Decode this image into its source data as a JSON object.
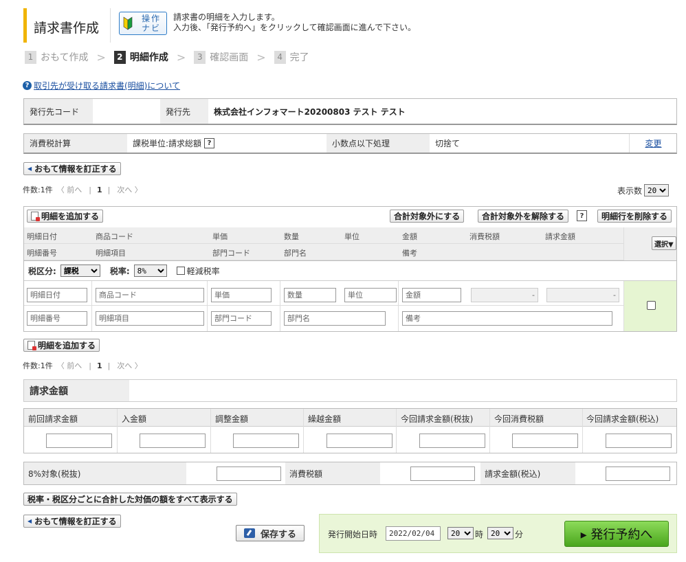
{
  "header": {
    "title": "請求書作成",
    "navi_label": "操作ナビ",
    "instruction_line1": "請求書の明細を入力します。",
    "instruction_line2": "入力後、「発行予約へ」をクリックして確認画面に進んで下さい。"
  },
  "steps": [
    {
      "num": "1",
      "label": "おもて作成"
    },
    {
      "num": "2",
      "label": "明細作成"
    },
    {
      "num": "3",
      "label": "確認画面"
    },
    {
      "num": "4",
      "label": "完了"
    }
  ],
  "help_link": "取引先が受け取る請求書(明細)について",
  "issuer": {
    "code_label": "発行先コード",
    "code_value": "",
    "name_label": "発行先",
    "name_value": "株式会社インフォマート20200803 テスト テスト"
  },
  "tax": {
    "calc_label": "消費税計算",
    "unit_value": "課税単位:請求総額",
    "decimal_label": "小数点以下処理",
    "decimal_value": "切捨て",
    "change_link": "変更"
  },
  "correct_button": "おもて情報を訂正する",
  "pager": {
    "count": "件数:1件",
    "prev": "〈 前へ",
    "page": "1",
    "next": "次へ 〉"
  },
  "display_count_label": "表示数",
  "display_count_value": "20",
  "toolbar": {
    "add_detail": "明細を追加する",
    "set_total": "合計対象外にする",
    "unset_total": "合計対象外を解除する",
    "delete_row": "明細行を削除する",
    "select": "選択▼"
  },
  "grid_header": {
    "row1": [
      "明細日付",
      "商品コード",
      "単価",
      "数量",
      "単位",
      "金額",
      "消費税額",
      "請求金額"
    ],
    "row2": [
      "明細番号",
      "明細項目",
      "部門コード",
      "部門名",
      "備考"
    ]
  },
  "tax_class": {
    "label": "税区分:",
    "value": "課税",
    "rate_label": "税率:",
    "rate_value": "8%",
    "reduced_label": "軽減税率"
  },
  "row_placeholders": {
    "date": "明細日付",
    "product_code": "商品コード",
    "unit_price": "単価",
    "quantity": "数量",
    "unit": "単位",
    "amount": "金額",
    "dash1": "-",
    "dash2": "-",
    "number": "明細番号",
    "item": "明細項目",
    "dept_code": "部門コード",
    "dept_name": "部門名",
    "note": "備考"
  },
  "invoice": {
    "title": "請求金額",
    "headers": [
      "前回請求金額",
      "入金額",
      "調整金額",
      "繰越金額",
      "今回請求金額(税抜)",
      "今回消費税額",
      "今回請求金額(税込)"
    ],
    "subtotal_label": "8%対象(税抜)",
    "tax_label": "消費税額",
    "total_label": "請求金額(税込)"
  },
  "show_all_button": "税率・税区分ごとに合計した対価の額をすべて表示する",
  "save_button": "保存する",
  "issue": {
    "date_label": "発行開始日時",
    "date_value": "2022/02/04",
    "hour_value": "20",
    "hour_label": "時",
    "minute_value": "20",
    "minute_label": "分",
    "submit": "▸ 発行予約へ"
  }
}
